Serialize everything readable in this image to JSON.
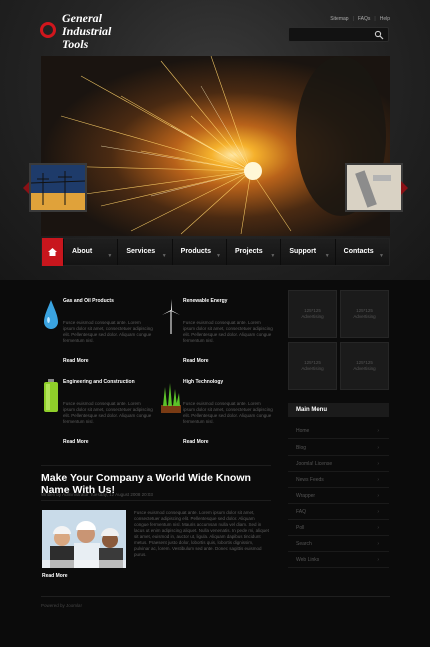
{
  "brand": {
    "logo_text": "General Industrial Tools"
  },
  "top_links": [
    "Sitemap",
    "FAQs",
    "Help"
  ],
  "nav": {
    "items": [
      "About",
      "Services",
      "Products",
      "Projects",
      "Support",
      "Contacts"
    ]
  },
  "features": [
    {
      "title": "Gas and Oil Products",
      "text": "Fusce euismod consequat ante. Lorem ipsum dolor sit amet, consectetuer adipiscing elit. Pellentesque sed dolor. Aliquam congue fermentum nisl.",
      "more": "Read More",
      "icon": "oil-drop-icon"
    },
    {
      "title": "Renewable Energy",
      "text": "Fusce euismod consequat ante. Lorem ipsum dolor sit amet, consectetuer adipiscing elit. Pellentesque sed dolor. Aliquam congue fermentum nisl.",
      "more": "Read More",
      "icon": "wind-turbine-icon"
    },
    {
      "title": "Engineering and Construction",
      "text": "Fusce euismod consequat ante. Lorem ipsum dolor sit amet, consectetuer adipiscing elit. Pellentesque sed dolor. Aliquam congue fermentum nisl.",
      "more": "Read More",
      "icon": "battery-icon"
    },
    {
      "title": "High Technology",
      "text": "Fusce euismod consequat ante. Lorem ipsum dolor sit amet, consectetuer adipiscing elit. Pellentesque sed dolor. Aliquam congue fermentum nisl.",
      "more": "Read More",
      "icon": "grass-icon"
    }
  ],
  "article": {
    "headline": "Make Your Company a World Wide Known Name With Us!",
    "byline": "Written by Administrator Tuesday, 12 August 2008 20:03",
    "text": "Fusce euismod consequat ante. Lorem ipsum dolor sit amet, consectetuer adipiscing elit. Pellentesque sed dolor. Aliquam congue fermentum nisl. Mauris accumsan nulla vel diam. Sed in lacus ut enim adipiscing aliquet. Nulla venenatis. In pede mi, aliquet sit amet, euismod in, auctor ut, ligula. Aliquam dapibus tincidunt metus. Praesent justo dolor, lobortis quis, lobortis dignissim, pulvinar ac, lorem. Vestibulum sed ante. Donec sagittis euismod purus.",
    "more": "Read More"
  },
  "ads": [
    {
      "size": "125*125",
      "label": "Advertising"
    },
    {
      "size": "125*125",
      "label": "Advertising"
    },
    {
      "size": "125*125",
      "label": "Advertising"
    },
    {
      "size": "125*125",
      "label": "Advertising"
    }
  ],
  "main_menu": {
    "title": "Main Menu",
    "items": [
      "Home",
      "Blog",
      "Joomla! License",
      "News Feeds",
      "Wrapper",
      "FAQ",
      "Poll",
      "Search",
      "Web Links"
    ]
  },
  "footer": {
    "text": "Powered by Joomla!"
  },
  "colors": {
    "accent": "#c8161d",
    "background": "#0b0b0b"
  }
}
